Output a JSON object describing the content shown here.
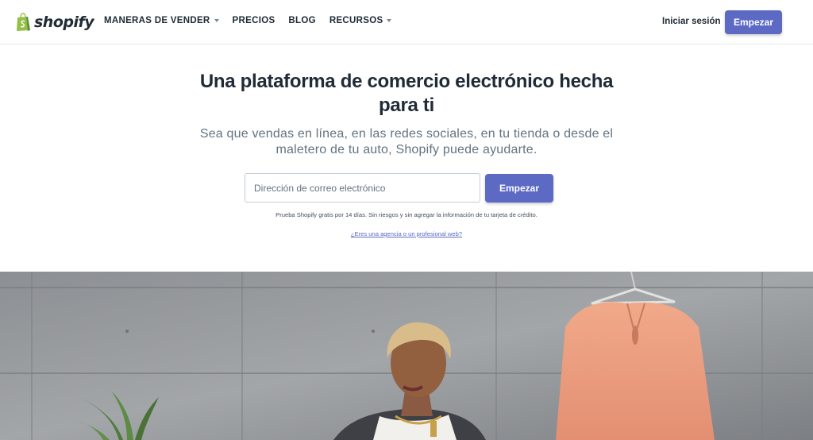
{
  "nav": {
    "logo_text": "shopify",
    "menu": [
      {
        "label": "MANERAS DE VENDER",
        "has_dropdown": true
      },
      {
        "label": "PRECIOS",
        "has_dropdown": false
      },
      {
        "label": "BLOG",
        "has_dropdown": false
      },
      {
        "label": "RECURSOS",
        "has_dropdown": true
      }
    ],
    "login_label": "Iniciar sesión",
    "cta_label": "Empezar"
  },
  "hero": {
    "title_line1": "Una plataforma de comercio electrónico hecha",
    "title_line2": "para ti",
    "subtitle_line1": "Sea que vendas en línea, en las redes sociales, en tu tienda o desde el",
    "subtitle_line2": "maletero de tu auto, Shopify puede ayudarte.",
    "email_placeholder": "Dirección de correo electrónico",
    "cta_label": "Empezar",
    "trial_note": "Prueba Shopify gratis por 14 días. Sin riesgos y sin agregar la información de tu tarjeta de crédito.",
    "agency_link": "¿Eres una agencia o un profesional web?"
  },
  "colors": {
    "brand_green": "#95bf47",
    "accent_indigo": "#5c6ac4",
    "text_dark": "#212b36",
    "text_muted": "#637381"
  }
}
